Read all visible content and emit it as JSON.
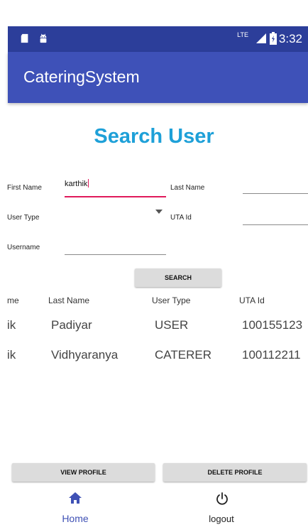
{
  "status_bar": {
    "network": "LTE",
    "time": "3:32",
    "icons": [
      "sd-card-icon",
      "android-icon",
      "signal-icon",
      "battery-icon"
    ]
  },
  "app": {
    "title": "CateringSystem"
  },
  "page": {
    "title": "Search User"
  },
  "form": {
    "first_name_label": "First Name",
    "first_name_value": "karthik",
    "last_name_label": "Last Name",
    "last_name_value": "",
    "user_type_label": "User Type",
    "user_type_value": "",
    "uta_id_label": "UTA Id",
    "uta_id_value": "",
    "username_label": "Username",
    "username_value": "",
    "search_button": "SEARCH"
  },
  "results": {
    "headers": [
      "me",
      "Last Name",
      "User Type",
      "UTA Id"
    ],
    "rows": [
      [
        "ik",
        "Padiyar",
        "USER",
        "100155123"
      ],
      [
        "ik",
        "Vidhyaranya",
        "CATERER",
        "100112211"
      ]
    ]
  },
  "actions": {
    "view_profile": "VIEW PROFILE",
    "delete_profile": "DELETE PROFILE"
  },
  "bottom_nav": {
    "home_label": "Home",
    "logout_label": "logout",
    "active_color": "#3f51b5"
  },
  "colors": {
    "status_bar": "#2c3e9a",
    "app_bar": "#3e51b8",
    "title": "#1ea0d8",
    "accent": "#e0195b"
  }
}
